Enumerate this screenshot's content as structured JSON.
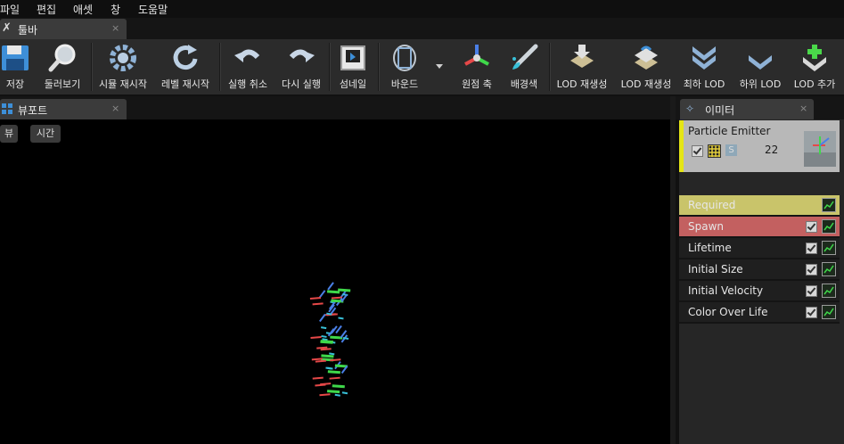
{
  "menu": {
    "items": [
      "파일",
      "편집",
      "애셋",
      "창",
      "도움말"
    ]
  },
  "toolbar_tab": {
    "label": "툴바",
    "close": "×"
  },
  "toolbar": {
    "save": "저장",
    "browse": "둘러보기",
    "restart_sim": "시뮬 재시작",
    "restart_level": "레벨 재시작",
    "undo": "실행 취소",
    "redo": "다시 실행",
    "thumbnail": "섬네일",
    "bounds": "바운드",
    "origin_axis": "원점 축",
    "background_color": "배경색",
    "regen_lod_1": "LOD 재생성",
    "regen_lod_2": "LOD 재생성",
    "lowest_lod": "최하 LOD",
    "lower_lod": "하위 LOD",
    "add_lod": "LOD 추가"
  },
  "viewport": {
    "tab_label": "뷰포트",
    "close": "×",
    "view_button": "뷰",
    "time_button": "시간"
  },
  "emitters": {
    "tab_label": "이미터",
    "close": "×",
    "emitter_name": "Particle Emitter",
    "particle_count": "22",
    "solo_label": "S",
    "modules": [
      {
        "label": "Required",
        "bg": "#c9c46a",
        "checkbox": false
      },
      {
        "label": "Spawn",
        "bg": "#c36060",
        "checkbox": true
      },
      {
        "label": "Lifetime",
        "bg": "#1f1f1f",
        "checkbox": true
      },
      {
        "label": "Initial Size",
        "bg": "#1f1f1f",
        "checkbox": true
      },
      {
        "label": "Initial Velocity",
        "bg": "#1f1f1f",
        "checkbox": true
      },
      {
        "label": "Color Over Life",
        "bg": "#1f1f1f",
        "checkbox": true
      }
    ]
  },
  "colors": {
    "accent_yellow": "#e5e515",
    "required_row": "#c9c46a",
    "spawn_row": "#c36060"
  }
}
